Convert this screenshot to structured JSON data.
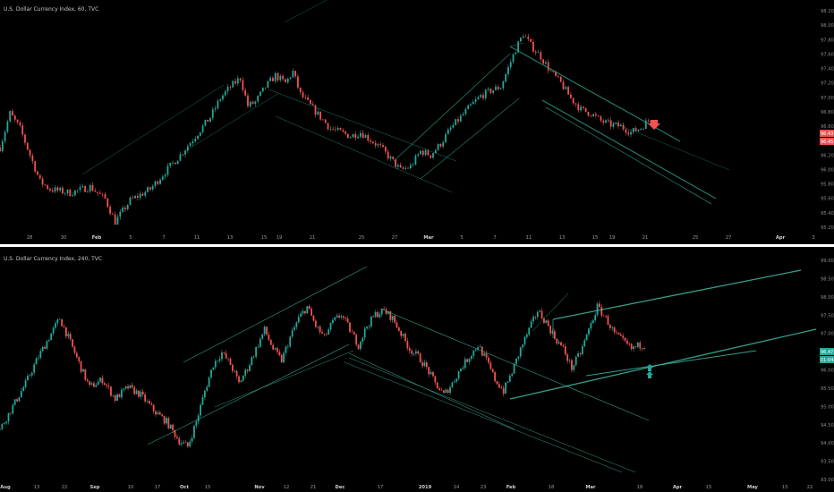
{
  "colors": {
    "background": "#000000",
    "up": "#26a69a",
    "down": "#ef5350",
    "channel": "#2a8f7f",
    "channel_bright": "#3fb8a2",
    "divider": "#ffffff",
    "arrow_down": "#ef5350",
    "arrow_up": "#26a69a"
  },
  "chart_data": [
    {
      "type": "candlestick",
      "title": "U.S. Dollar Currency Index, 60, TVC",
      "x_labels": [
        "28",
        "30",
        "Feb",
        "5",
        "7",
        "11",
        "13",
        "15",
        "19",
        "21",
        "25",
        "27",
        "Mar",
        "5",
        "7",
        "11",
        "13",
        "15",
        "19",
        "21",
        "25",
        "27",
        "Apr",
        "3"
      ],
      "y_ticks": [
        "98.20",
        "98.00",
        "97.80",
        "97.60",
        "97.40",
        "97.20",
        "97.00",
        "96.80",
        "96.60",
        "96.40",
        "96.20",
        "96.00",
        "95.80",
        "95.60",
        "95.40",
        "95.20"
      ],
      "ylim": [
        95.2,
        98.2
      ],
      "price_badges": [
        "96.43",
        "96.45"
      ],
      "close_trace": [
        [
          0,
          96.3
        ],
        [
          2,
          96.75
        ],
        [
          4,
          96.55
        ],
        [
          6,
          96.2
        ],
        [
          8,
          95.85
        ],
        [
          10,
          95.75
        ],
        [
          14,
          95.7
        ],
        [
          18,
          95.78
        ],
        [
          21,
          95.62
        ],
        [
          23,
          95.32
        ],
        [
          26,
          95.6
        ],
        [
          30,
          95.75
        ],
        [
          33,
          95.98
        ],
        [
          36,
          96.2
        ],
        [
          39,
          96.45
        ],
        [
          42,
          96.7
        ],
        [
          44,
          96.95
        ],
        [
          46,
          97.1
        ],
        [
          48,
          97.22
        ],
        [
          49.5,
          96.85
        ],
        [
          51,
          96.9
        ],
        [
          53,
          97.1
        ],
        [
          55,
          97.25
        ],
        [
          57,
          97.15
        ],
        [
          58.5,
          97.3
        ],
        [
          60,
          97.0
        ],
        [
          62,
          96.85
        ],
        [
          64,
          96.7
        ],
        [
          66,
          96.55
        ],
        [
          68,
          96.5
        ],
        [
          70,
          96.45
        ],
        [
          72,
          96.5
        ],
        [
          74,
          96.4
        ],
        [
          76,
          96.3
        ],
        [
          78,
          96.15
        ],
        [
          80,
          96.0
        ],
        [
          82,
          96.05
        ],
        [
          84,
          96.25
        ],
        [
          86,
          96.2
        ],
        [
          88,
          96.35
        ],
        [
          90,
          96.55
        ],
        [
          92,
          96.7
        ],
        [
          94,
          96.85
        ],
        [
          96,
          96.98
        ],
        [
          98,
          97.05
        ],
        [
          100,
          97.1
        ],
        [
          101.5,
          97.35
        ],
        [
          103,
          97.6
        ],
        [
          104.5,
          97.8
        ],
        [
          106,
          97.65
        ],
        [
          108,
          97.5
        ],
        [
          110,
          97.3
        ],
        [
          112,
          97.15
        ],
        [
          114,
          96.95
        ],
        [
          116,
          96.8
        ],
        [
          118,
          96.75
        ],
        [
          120,
          96.65
        ],
        [
          122,
          96.6
        ],
        [
          124,
          96.58
        ],
        [
          126,
          96.5
        ],
        [
          128,
          96.56
        ],
        [
          129.5,
          96.66
        ]
      ]
    },
    {
      "type": "candlestick",
      "title": "U.S. Dollar Currency Index, 240, TVC",
      "x_labels": [
        "Aug",
        "13",
        "22",
        "Sep",
        "10",
        "17",
        "Oct",
        "15",
        "Nov",
        "12",
        "21",
        "Dec",
        "17",
        "2019",
        "14",
        "23",
        "Feb",
        "18",
        "Mar",
        "18",
        "Apr",
        "15",
        "May",
        "13",
        "22"
      ],
      "y_ticks": [
        "99.00",
        "98.50",
        "98.00",
        "97.50",
        "97.00",
        "96.50",
        "96.00",
        "95.50",
        "95.00",
        "94.50",
        "94.00",
        "93.50",
        "93.00"
      ],
      "ylim": [
        93.0,
        99.0
      ],
      "price_badges": [
        "96.47",
        "01:04:59"
      ],
      "close_trace": [
        [
          0,
          94.4
        ],
        [
          3,
          95.0
        ],
        [
          6,
          95.6
        ],
        [
          9,
          96.3
        ],
        [
          12,
          96.9
        ],
        [
          14,
          97.3
        ],
        [
          16,
          96.8
        ],
        [
          19,
          96.0
        ],
        [
          21,
          95.5
        ],
        [
          24,
          95.7
        ],
        [
          27,
          95.2
        ],
        [
          30,
          95.5
        ],
        [
          33,
          95.3
        ],
        [
          36,
          94.9
        ],
        [
          39,
          94.6
        ],
        [
          42,
          94.1
        ],
        [
          44,
          93.95
        ],
        [
          46,
          94.6
        ],
        [
          48,
          95.4
        ],
        [
          50,
          96.1
        ],
        [
          52,
          96.4
        ],
        [
          54,
          96.1
        ],
        [
          56,
          95.6
        ],
        [
          58,
          96.0
        ],
        [
          60,
          96.5
        ],
        [
          62,
          97.0
        ],
        [
          64,
          96.5
        ],
        [
          66,
          96.2
        ],
        [
          68,
          96.8
        ],
        [
          70,
          97.3
        ],
        [
          72,
          97.6
        ],
        [
          74,
          97.1
        ],
        [
          76,
          96.8
        ],
        [
          78,
          97.2
        ],
        [
          80,
          97.4
        ],
        [
          82,
          97.0
        ],
        [
          84,
          96.6
        ],
        [
          86,
          97.1
        ],
        [
          88,
          97.4
        ],
        [
          90,
          97.5
        ],
        [
          92,
          97.3
        ],
        [
          94,
          96.9
        ],
        [
          96,
          96.5
        ],
        [
          98,
          96.3
        ],
        [
          100,
          96.0
        ],
        [
          102,
          95.6
        ],
        [
          104,
          95.3
        ],
        [
          106,
          95.6
        ],
        [
          108,
          96.0
        ],
        [
          110,
          96.3
        ],
        [
          112,
          96.6
        ],
        [
          114,
          96.2
        ],
        [
          116,
          95.7
        ],
        [
          118,
          95.4
        ],
        [
          120,
          95.9
        ],
        [
          122,
          96.5
        ],
        [
          124,
          97.0
        ],
        [
          126,
          97.5
        ],
        [
          128,
          97.2
        ],
        [
          130,
          96.8
        ],
        [
          132,
          96.5
        ],
        [
          134,
          96.0
        ],
        [
          136,
          96.4
        ],
        [
          138,
          97.0
        ],
        [
          140,
          97.6
        ],
        [
          142,
          97.3
        ],
        [
          144,
          96.9
        ],
        [
          146,
          96.7
        ],
        [
          148,
          96.5
        ],
        [
          150,
          96.6
        ]
      ]
    }
  ]
}
